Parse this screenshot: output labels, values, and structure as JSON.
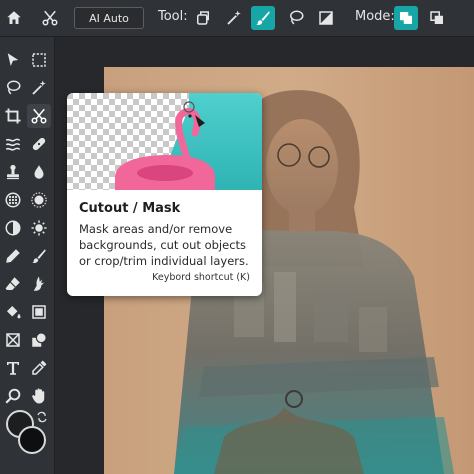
{
  "topbar": {
    "ai_auto_label": "AI Auto",
    "tool_label": "Tool:",
    "mode_label": "Mode:",
    "icons": [
      "home-icon",
      "scissors-icon",
      "lasso-tool-icon",
      "magic-wand-icon",
      "brush-icon",
      "lasso-icon",
      "gradient-icon",
      "mode-replace-icon",
      "mode-subtract-icon"
    ]
  },
  "toolbar": {
    "tools": [
      "arrow-icon",
      "marquee-icon",
      "lasso-icon",
      "magic-wand-icon",
      "crop-icon",
      "cutout-scissors-icon",
      "liquify-icon",
      "healing-icon",
      "stamp-icon",
      "blur-icon",
      "sponge-icon",
      "drop-icon",
      "dodge-icon",
      "sharpen-icon",
      "pencil-icon",
      "brush-icon",
      "eraser-icon",
      "smudge-icon",
      "fill-icon",
      "rect-icon",
      "frame-icon",
      "shape-icon",
      "text-icon",
      "eyedropper-icon",
      "zoom-icon",
      "hand-icon"
    ],
    "selected_tool": "cutout-scissors-icon"
  },
  "tooltip": {
    "title": "Cutout / Mask",
    "description": "Mask areas and/or remove backgrounds, cut out objects or crop/trim individual layers.",
    "shortcut": "Keybord shortcut (K)"
  },
  "colors": {
    "accent": "#17a6a6",
    "foreground": "#1d1e20",
    "background": "#0e0f10"
  }
}
